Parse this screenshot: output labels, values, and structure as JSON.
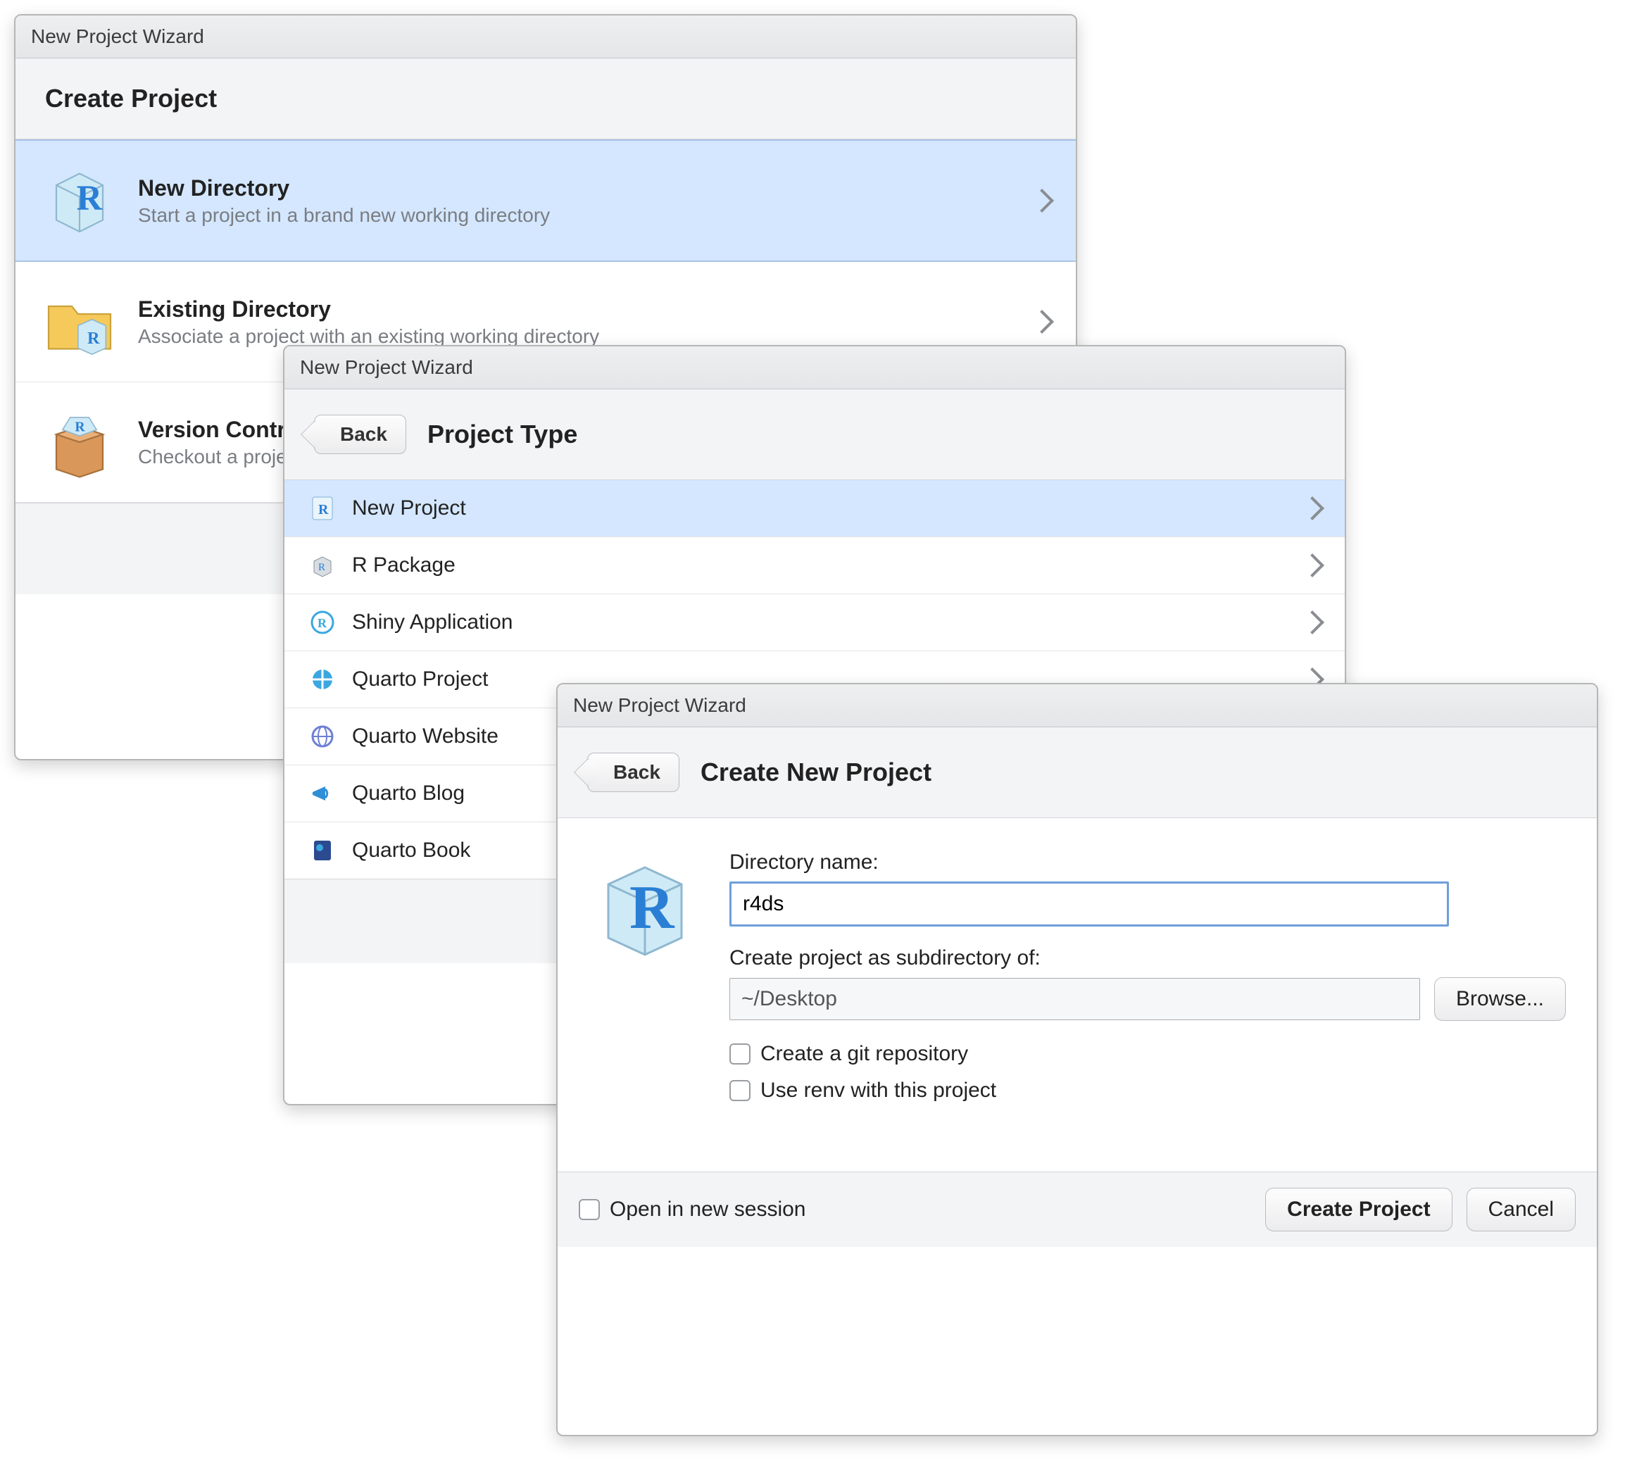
{
  "dlg1": {
    "titlebar": "New Project Wizard",
    "heading": "Create Project",
    "options": [
      {
        "title": "New Directory",
        "subtitle": "Start a project in a brand new working directory"
      },
      {
        "title": "Existing Directory",
        "subtitle": "Associate a project with an existing working directory"
      },
      {
        "title": "Version Control",
        "subtitle": "Checkout a project from a version control repository"
      }
    ]
  },
  "dlg2": {
    "titlebar": "New Project Wizard",
    "back": "Back",
    "heading": "Project Type",
    "types": [
      "New Project",
      "R Package",
      "Shiny Application",
      "Quarto Project",
      "Quarto Website",
      "Quarto Blog",
      "Quarto Book"
    ]
  },
  "dlg3": {
    "titlebar": "New Project Wizard",
    "back": "Back",
    "heading": "Create New Project",
    "dir_label": "Directory name:",
    "dir_value": "r4ds",
    "subdir_label": "Create project as subdirectory of:",
    "subdir_value": "~/Desktop",
    "browse": "Browse...",
    "git_label": "Create a git repository",
    "renv_label": "Use renv with this project",
    "open_new": "Open in new session",
    "create": "Create Project",
    "cancel": "Cancel"
  }
}
